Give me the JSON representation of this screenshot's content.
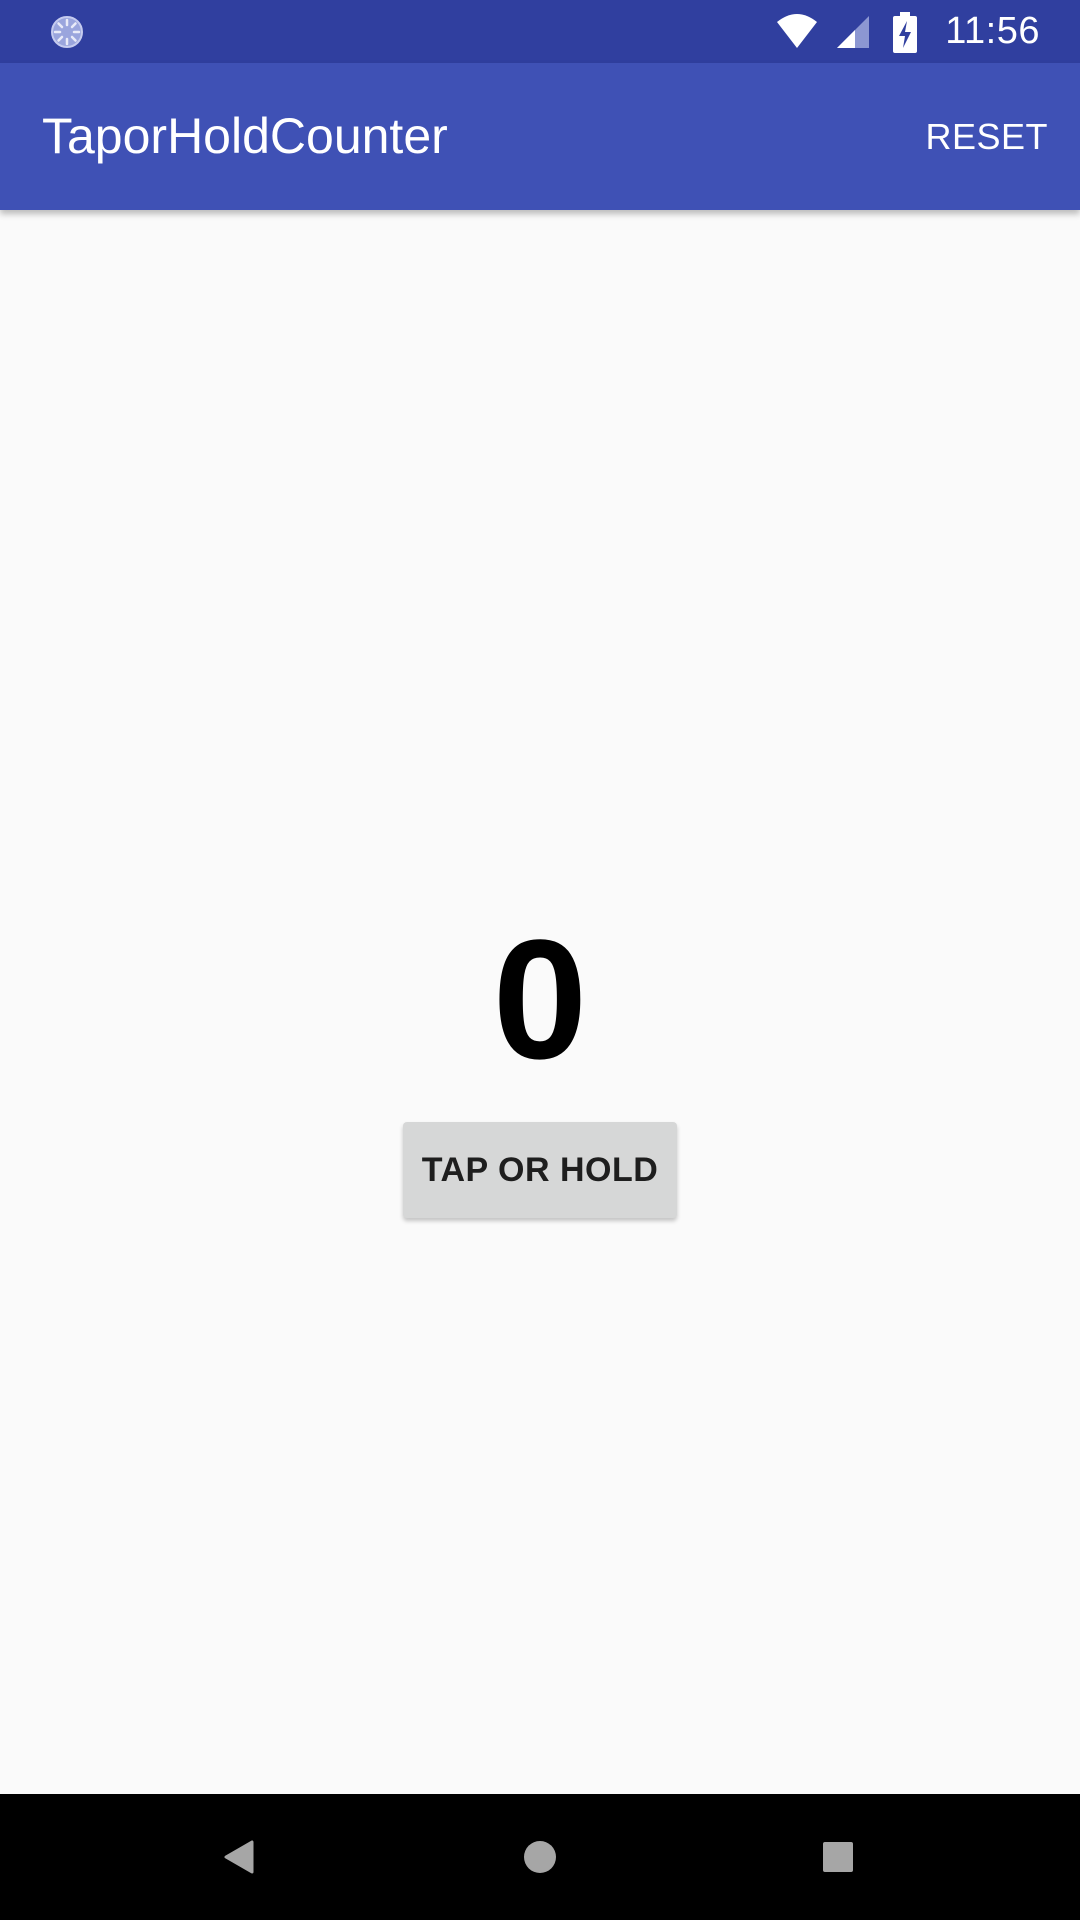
{
  "status_bar": {
    "time": "11:56",
    "background_color": "#303f9f",
    "icons": [
      "loading-spinner-icon",
      "wifi-icon",
      "cell-signal-icon",
      "battery-charging-icon"
    ]
  },
  "app_bar": {
    "title": "TaporHoldCounter",
    "reset_label": "RESET",
    "background_color": "#3f51b5"
  },
  "main": {
    "counter_value": "0",
    "button_label": "TAP OR HOLD"
  },
  "nav_bar": {
    "buttons": [
      "back-icon",
      "home-icon",
      "recents-icon"
    ]
  }
}
